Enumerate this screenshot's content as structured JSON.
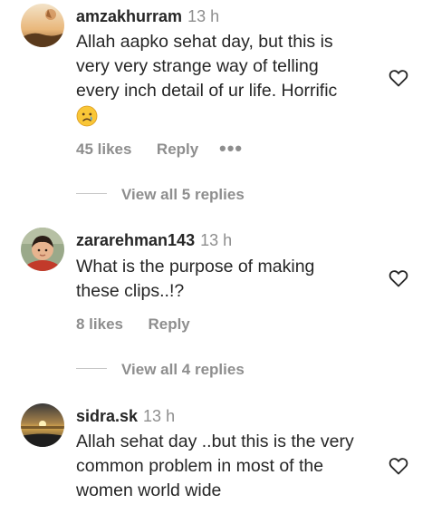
{
  "comments": [
    {
      "username": "amzakhurram",
      "time": "13 h",
      "text_lines": [
        "Allah aapko sehat day, but this is",
        "very very strange way of telling",
        "every inch detail of ur life. Horrific"
      ],
      "emoji": "crying-face",
      "likes": "45 likes",
      "reply": "Reply",
      "more": "•••",
      "view_replies": "View all 5 replies"
    },
    {
      "username": "zararehman143",
      "time": "13 h",
      "text_lines": [
        "What is the purpose of making",
        "these clips..!?"
      ],
      "likes": "8 likes",
      "reply": "Reply",
      "view_replies": "View all 4 replies"
    },
    {
      "username": "sidra.sk",
      "time": "13 h",
      "text_lines": [
        "Allah sehat day ..but this is the very",
        "common problem in most of the",
        "women world wide"
      ]
    }
  ],
  "colors": {
    "text": "#262626",
    "secondary": "#8e8e8e",
    "divider": "#c7c7c7"
  },
  "icons": [
    "heart-icon",
    "more-options-icon",
    "crying-face-emoji"
  ]
}
